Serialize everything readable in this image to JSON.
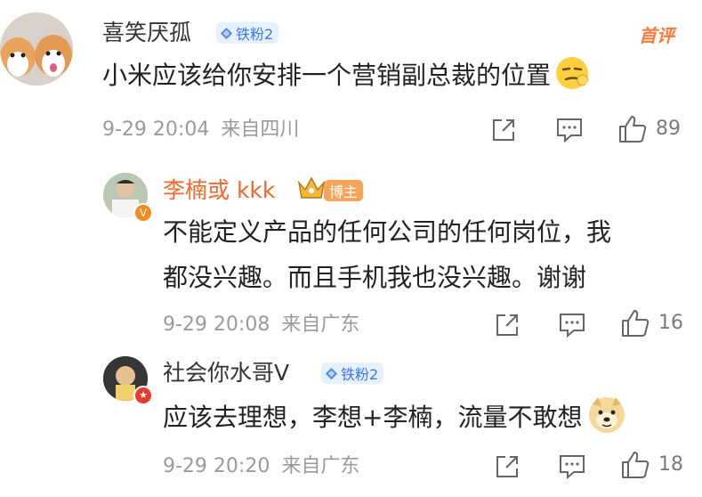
{
  "comments": [
    {
      "username": "喜笑厌孤",
      "fan_badge": "铁粉2",
      "hot_tag": "首评",
      "text": "小米应该给你安排一个营销副总裁的位置",
      "timestamp": "9-29 20:04",
      "location": "来自四川",
      "likes": "89"
    },
    {
      "username": "李楠或 kkk",
      "author_badge": "博主",
      "text_line1": "不能定义产品的任何公司的任何岗位，我",
      "text_line2": "都没兴趣。而且手机我也没兴趣。谢谢",
      "timestamp": "9-29 20:08",
      "location": "来自广东",
      "likes": "16"
    },
    {
      "username": "社会你水哥Ⅴ",
      "fan_badge": "铁粉2",
      "text": "应该去理想，李想+李楠，流量不敢想",
      "timestamp": "9-29 20:20",
      "location": "来自广东",
      "likes": "18"
    }
  ],
  "colors": {
    "author_name": "#f2682a",
    "badge_blue": "#3a78ee",
    "hot_orange": "#ff7a3a",
    "meta_gray": "#9a9a9a"
  }
}
